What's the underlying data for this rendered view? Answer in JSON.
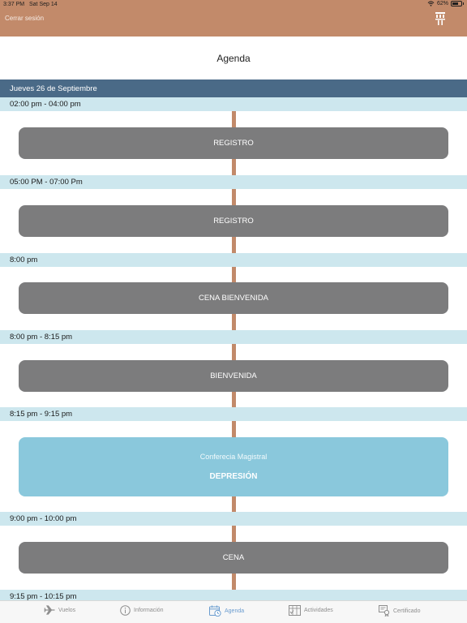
{
  "status_bar": {
    "time": "3:37 PM",
    "date": "Sat Sep 14",
    "battery": "62%"
  },
  "header": {
    "logout_label": "Cerrar sesión",
    "logo_icon": "institution-logo-icon"
  },
  "page": {
    "title": "Agenda"
  },
  "agenda": {
    "date_label": "Jueves 26 de Septiembre",
    "times": [
      "02:00 pm - 04:00 pm",
      "05:00 PM - 07:00 Pm",
      "8:00 pm",
      "8:00 pm - 8:15 pm",
      "8:15 pm - 9:15 pm",
      "9:00 pm - 10:00 pm",
      "9:15 pm - 10:15 pm"
    ],
    "events": [
      {
        "title": "REGISTRO"
      },
      {
        "title": "REGISTRO"
      },
      {
        "title": "CENA BIENVENIDA"
      },
      {
        "title": "BIENVENIDA"
      },
      {
        "subtitle": "Conferecia Magistral",
        "title": "DEPRESIÓN"
      },
      {
        "title": "CENA"
      }
    ]
  },
  "colors": {
    "header": "#c28a6a",
    "date_bar": "#4a6a87",
    "time_row": "#cde7ee",
    "card": "#7c7c7d",
    "highlight_card": "#8ac8dc",
    "timeline": "#c28a6a",
    "tab_active": "#6a9ccf",
    "tab_inactive": "#8e8e8e"
  },
  "tabs": [
    {
      "label": "Vuelos",
      "icon": "airplane-icon",
      "active": false
    },
    {
      "label": "Información",
      "icon": "info-icon",
      "active": false
    },
    {
      "label": "Agenda",
      "icon": "calendar-icon",
      "active": true
    },
    {
      "label": "Actividades",
      "icon": "activities-icon",
      "active": false
    },
    {
      "label": "Certificado",
      "icon": "certificate-icon",
      "active": false
    }
  ]
}
